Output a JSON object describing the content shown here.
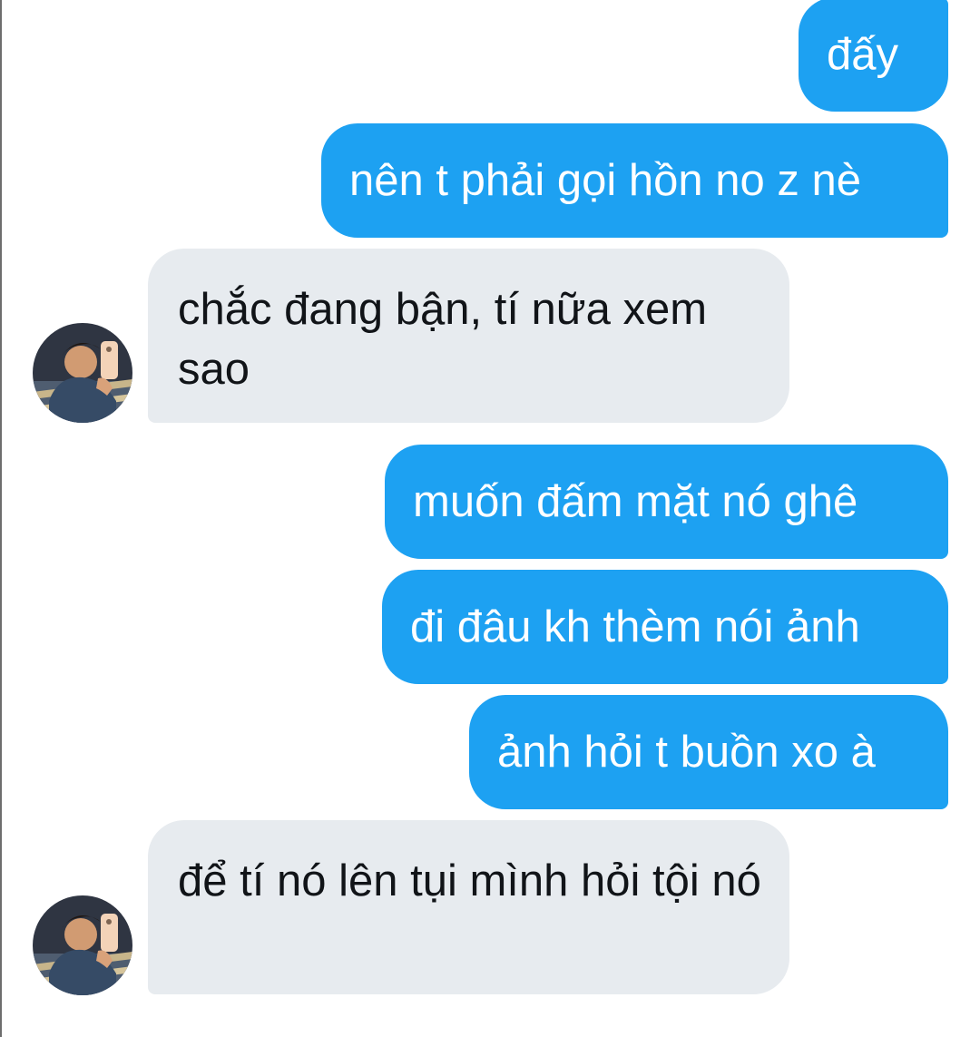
{
  "messages": [
    {
      "direction": "sent",
      "text": "đấy"
    },
    {
      "direction": "sent",
      "text": "nên t phải gọi hồn no z nè"
    },
    {
      "direction": "received",
      "text": "chắc đang bận, tí nữa xem sao"
    },
    {
      "direction": "sent",
      "text": "muốn đấm mặt nó ghê"
    },
    {
      "direction": "sent",
      "text": "đi đâu kh thèm nói ảnh"
    },
    {
      "direction": "sent",
      "text": "ảnh hỏi t buồn xo à"
    },
    {
      "direction": "received",
      "text": "để tí nó lên tụi mình hỏi tội nó"
    }
  ],
  "colors": {
    "sent_bubble": "#1da1f2",
    "received_bubble": "#e7ebef",
    "sent_text": "#ffffff",
    "received_text": "#111418"
  },
  "avatar_icon": "user-photo-avatar"
}
